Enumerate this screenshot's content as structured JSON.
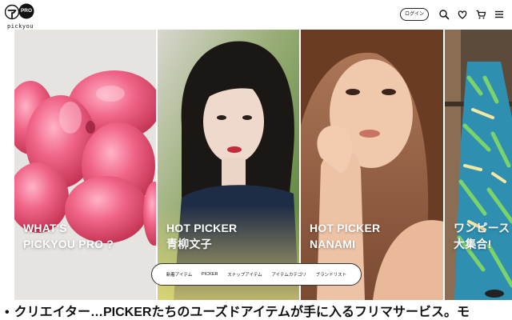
{
  "header": {
    "logo_wordmark": "pickyou",
    "logo_badge": "PRO",
    "login_label": "ログイン",
    "icons": [
      "search-icon",
      "heart-icon",
      "cart-icon",
      "menu-icon"
    ]
  },
  "hero": {
    "panels": [
      {
        "id": "pickyou-pro",
        "caption_lines": [
          "WHAT'S",
          "PICKYOU PRO ?"
        ],
        "tone": "#e5e3df"
      },
      {
        "id": "aoyagi",
        "caption_lines": [
          "HOT PICKER",
          "青柳文子"
        ],
        "tone": "#5f8a3a"
      },
      {
        "id": "nanami",
        "caption_lines": [
          "HOT PICKER",
          "NANAMI"
        ],
        "tone": "#c08a68"
      },
      {
        "id": "onepiece",
        "caption_lines": [
          "ワンピース",
          "大集合!"
        ],
        "tone": "#3a9bb6"
      }
    ]
  },
  "category_nav": {
    "items": [
      "新着アイテム",
      "PICKER",
      "スナップアイテム",
      "アイテムカテゴリ",
      "ブランドリスト"
    ]
  },
  "ticker": {
    "bullet": "•",
    "text": "クリエイター…PICKERたちのユーズドアイテムが手に入るフリマサービス。モ"
  },
  "colors": {
    "accent_pink": "#f0607e",
    "text": "#111111",
    "background": "#ffffff"
  }
}
